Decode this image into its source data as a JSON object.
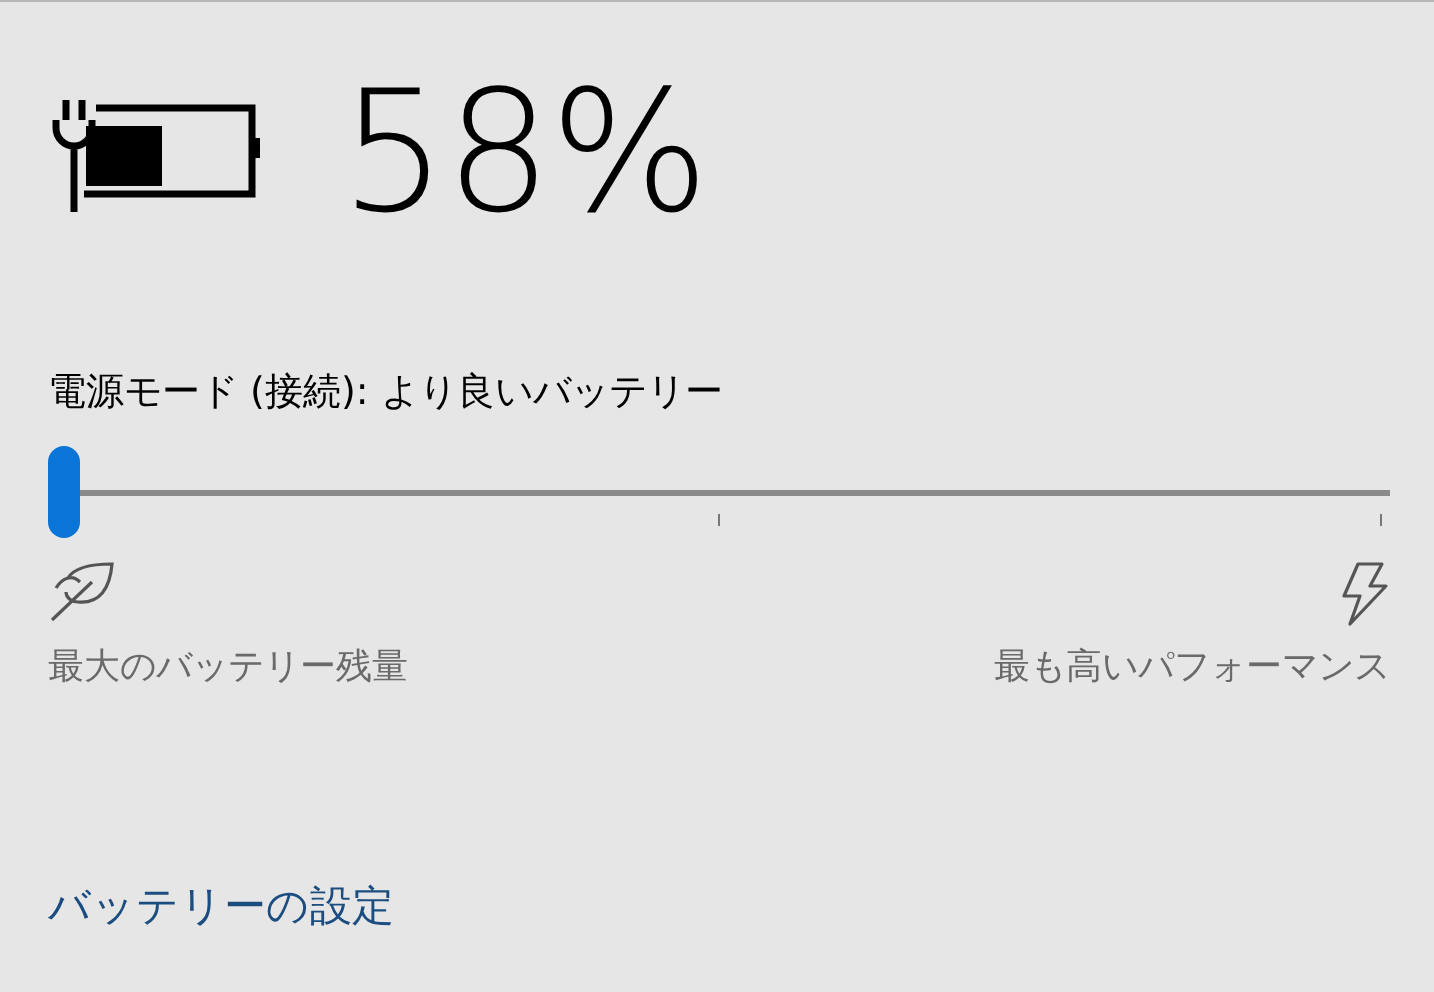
{
  "battery": {
    "percent": "58%",
    "plugged_in": true
  },
  "power_mode": {
    "label": "電源モード (接続): より良いバッテリー",
    "level": 0,
    "min_label": "最大のバッテリー残量",
    "max_label": "最も高いパフォーマンス"
  },
  "settings_link": "バッテリーの設定"
}
